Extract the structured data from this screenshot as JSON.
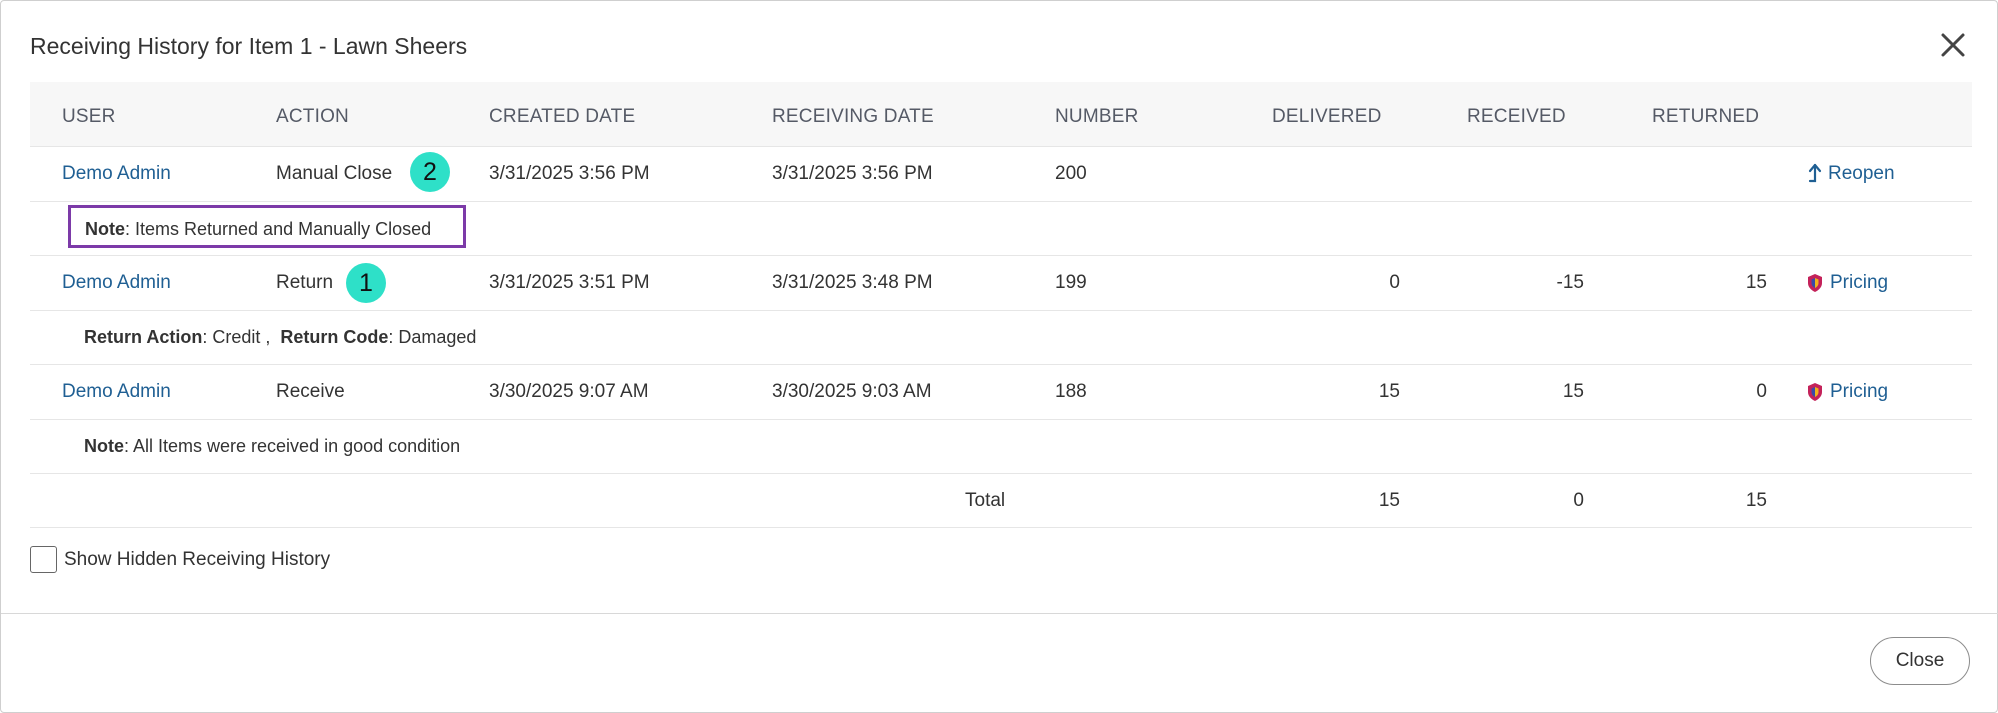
{
  "dialog": {
    "title": "Receiving History for Item 1 - Lawn Sheers",
    "close_icon": "close-x-icon"
  },
  "table": {
    "headers": {
      "user": "USER",
      "action": "ACTION",
      "created_date": "CREATED DATE",
      "receiving_date": "RECEIVING DATE",
      "number": "NUMBER",
      "delivered": "DELIVERED",
      "received": "RECEIVED",
      "returned": "RETURNED"
    },
    "rows": [
      {
        "user": "Demo Admin",
        "action": "Manual Close",
        "created_date": "3/31/2025 3:56 PM",
        "receiving_date": "3/31/2025 3:56 PM",
        "number": "200",
        "delivered": "",
        "received": "",
        "returned": "",
        "action_link": "Reopen",
        "action_icon": "reopen-arrow-icon",
        "badge": "2",
        "note_label": "Note",
        "note_text": ": Items Returned and Manually Closed"
      },
      {
        "user": "Demo Admin",
        "action": "Return",
        "created_date": "3/31/2025 3:51 PM",
        "receiving_date": "3/31/2025 3:48 PM",
        "number": "199",
        "delivered": "0",
        "received": "-15",
        "returned": "15",
        "action_link": "Pricing",
        "action_icon": "shield-icon",
        "badge": "1",
        "return_action_label": "Return Action",
        "return_action_value": ": Credit ,",
        "return_code_label": "Return Code",
        "return_code_value": ": Damaged"
      },
      {
        "user": "Demo Admin",
        "action": "Receive",
        "created_date": "3/30/2025 9:07 AM",
        "receiving_date": "3/30/2025 9:03 AM",
        "number": "188",
        "delivered": "15",
        "received": "15",
        "returned": "0",
        "action_link": "Pricing",
        "action_icon": "shield-icon",
        "note_label": "Note",
        "note_text": ": All Items were received in good condition"
      }
    ],
    "total": {
      "label": "Total",
      "delivered": "15",
      "received": "0",
      "returned": "15"
    }
  },
  "show_hidden": {
    "label": "Show Hidden Receiving History",
    "checked": false
  },
  "footer": {
    "close_label": "Close"
  },
  "colors": {
    "link": "#1f5f93",
    "highlight_border": "#7c3aa8",
    "badge": "#2ee0c8",
    "shield_outer": "#c4225a",
    "shield_inner": "#f2b21b"
  }
}
